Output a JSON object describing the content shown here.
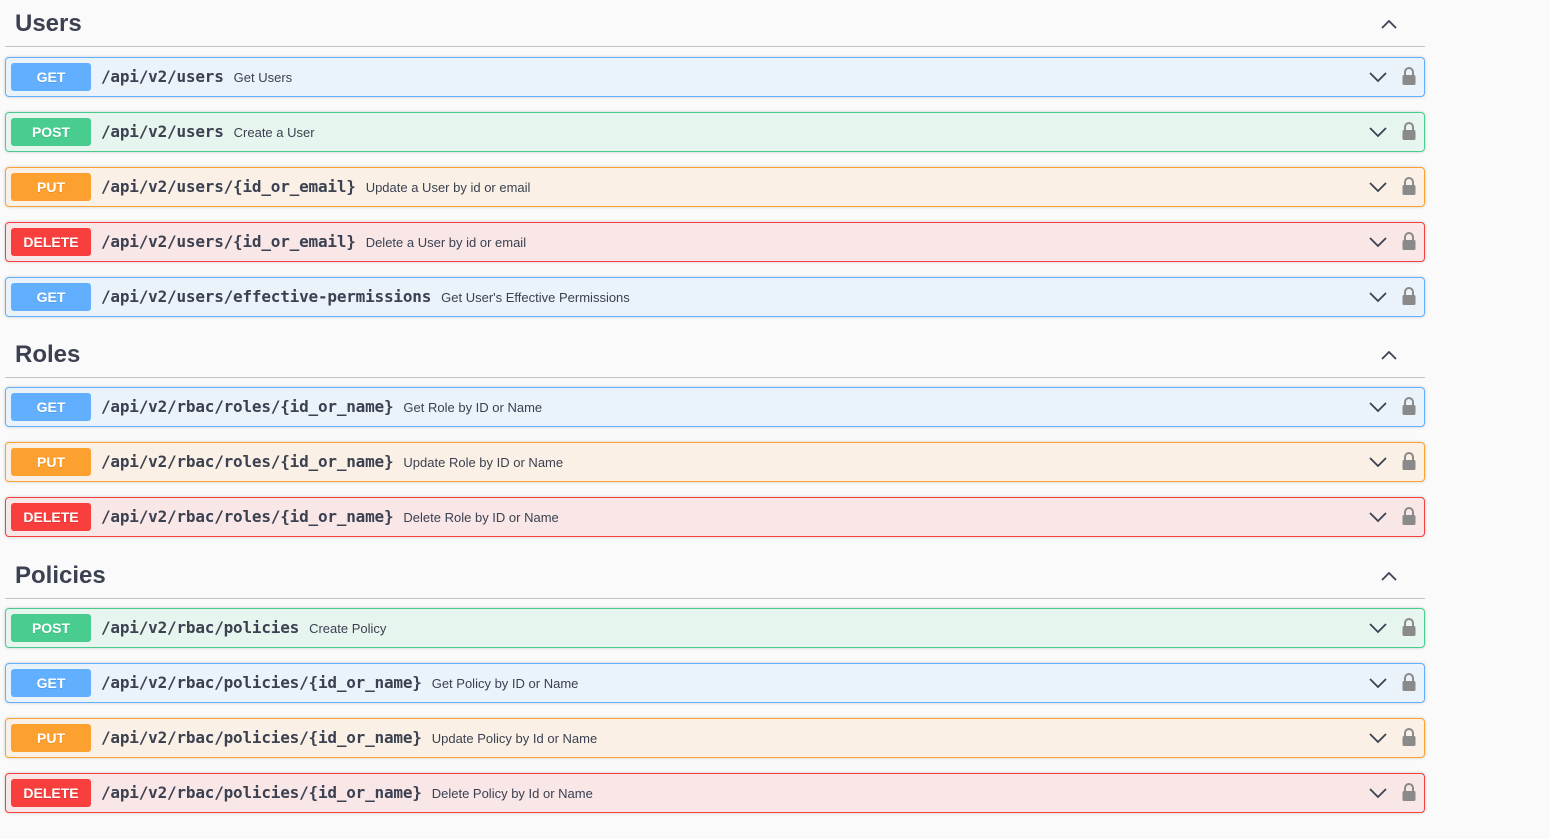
{
  "sections": [
    {
      "title": "Users",
      "operations": [
        {
          "method": "GET",
          "path": "/api/v2/users",
          "summary": "Get Users"
        },
        {
          "method": "POST",
          "path": "/api/v2/users",
          "summary": "Create a User"
        },
        {
          "method": "PUT",
          "path": "/api/v2/users/{id_or_email}",
          "summary": "Update a User by id or email"
        },
        {
          "method": "DELETE",
          "path": "/api/v2/users/{id_or_email}",
          "summary": "Delete a User by id or email"
        },
        {
          "method": "GET",
          "path": "/api/v2/users/effective-permissions",
          "summary": "Get User's Effective Permissions"
        }
      ]
    },
    {
      "title": "Roles",
      "operations": [
        {
          "method": "GET",
          "path": "/api/v2/rbac/roles/{id_or_name}",
          "summary": "Get Role by ID or Name"
        },
        {
          "method": "PUT",
          "path": "/api/v2/rbac/roles/{id_or_name}",
          "summary": "Update Role by ID or Name"
        },
        {
          "method": "DELETE",
          "path": "/api/v2/rbac/roles/{id_or_name}",
          "summary": "Delete Role by ID or Name"
        }
      ]
    },
    {
      "title": "Policies",
      "operations": [
        {
          "method": "POST",
          "path": "/api/v2/rbac/policies",
          "summary": "Create Policy"
        },
        {
          "method": "GET",
          "path": "/api/v2/rbac/policies/{id_or_name}",
          "summary": "Get Policy by ID or Name"
        },
        {
          "method": "PUT",
          "path": "/api/v2/rbac/policies/{id_or_name}",
          "summary": "Update Policy by Id or Name"
        },
        {
          "method": "DELETE",
          "path": "/api/v2/rbac/policies/{id_or_name}",
          "summary": "Delete Policy by Id or Name"
        }
      ]
    }
  ],
  "icons": {
    "section_toggle": "chevron-up-icon",
    "operation_toggle": "chevron-down-icon",
    "auth": "lock-icon"
  },
  "colors": {
    "get": "#61affe",
    "post": "#49cc90",
    "put": "#fca130",
    "delete": "#f93e3e",
    "text": "#3b4151"
  }
}
